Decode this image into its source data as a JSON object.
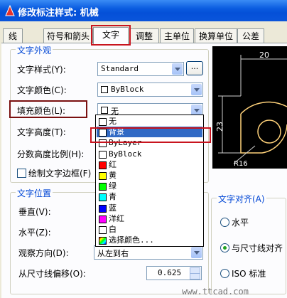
{
  "window": {
    "title": "修改标注样式: 机械"
  },
  "tabs": [
    {
      "label": "线"
    },
    {
      "label": "符号和箭头"
    },
    {
      "label": "文字"
    },
    {
      "label": "调整"
    },
    {
      "label": "主单位"
    },
    {
      "label": "换算单位"
    },
    {
      "label": "公差"
    }
  ],
  "text_appearance": {
    "legend": "文字外观",
    "style_label": "文字样式(Y):",
    "style_value": "Standard",
    "browse_label": "...",
    "color_label": "文字颜色(C):",
    "color_value": "ByBlock",
    "fill_label": "填充颜色(L):",
    "fill_value": "无",
    "height_label": "文字高度(T):",
    "fraction_label": "分数高度比例(H):",
    "frame_label": "绘制文字边框(F)"
  },
  "fill_dropdown": {
    "items": [
      {
        "label": "无",
        "color": "#ffffff"
      },
      {
        "label": "背景",
        "color": "#ffffff",
        "selected": true
      },
      {
        "label": "ByLayer",
        "color": "#ffffff"
      },
      {
        "label": "ByBlock",
        "color": "#ffffff"
      },
      {
        "label": "红",
        "color": "#ff0000"
      },
      {
        "label": "黄",
        "color": "#ffff00"
      },
      {
        "label": "绿",
        "color": "#00ff00"
      },
      {
        "label": "青",
        "color": "#00ffff"
      },
      {
        "label": "蓝",
        "color": "#0000ff"
      },
      {
        "label": "洋红",
        "color": "#ff00ff"
      },
      {
        "label": "白",
        "color": "#ffffff"
      },
      {
        "label": "选择颜色...",
        "color": "multi"
      }
    ]
  },
  "text_position": {
    "legend": "文字位置",
    "vertical_label": "垂直(V):",
    "horizontal_label": "水平(Z):",
    "view_dir_label": "观察方向(D):",
    "view_dir_value": "从左到右",
    "offset_label": "从尺寸线偏移(O):",
    "offset_value": "0.625"
  },
  "text_alignment": {
    "legend": "文字对齐(A)",
    "options": [
      {
        "label": "水平",
        "checked": false
      },
      {
        "label": "与尺寸线对齐",
        "checked": true
      },
      {
        "label": "ISO 标准",
        "checked": false
      }
    ]
  },
  "preview": {
    "dim_top": "20",
    "dim_left": "23",
    "dim_radius": "R16"
  },
  "watermark": "www.ttcad.com",
  "colors": {
    "title_bar": "#0a5ce0",
    "highlight": "#c8141e",
    "selection": "#316ac5",
    "legend_text": "#0046d5"
  }
}
